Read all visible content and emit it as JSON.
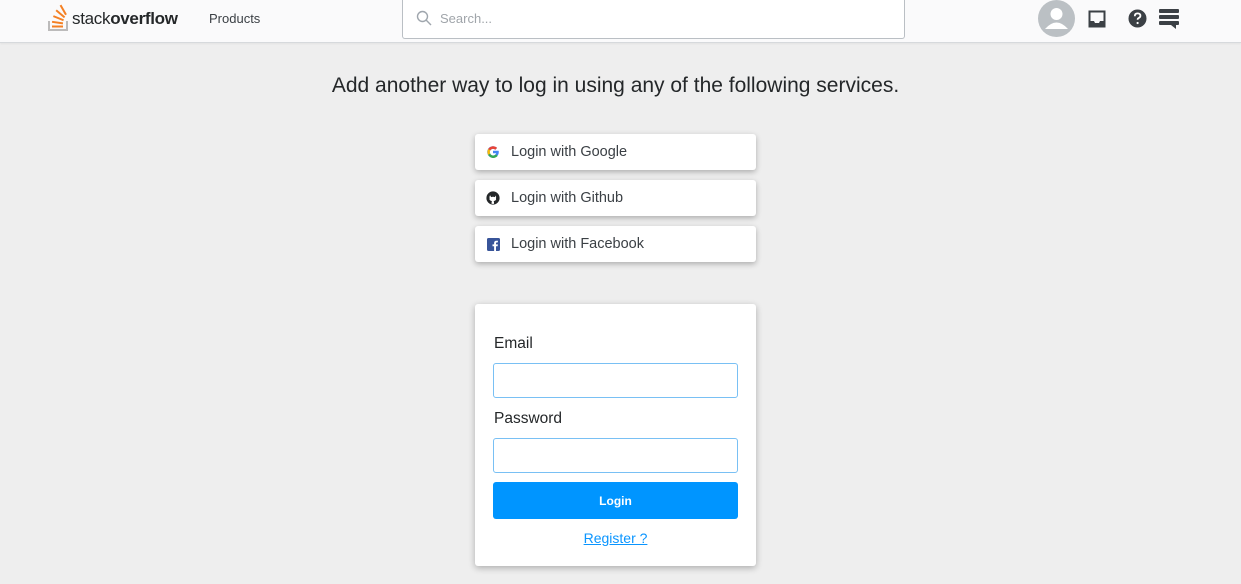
{
  "header": {
    "logo_light": "stack",
    "logo_bold": "overflow",
    "products_label": "Products",
    "search_placeholder": "Search..."
  },
  "main": {
    "headline": "Add another way to log in using any of the following services.",
    "social_buttons": [
      {
        "label": "Login with Google",
        "icon": "google-icon"
      },
      {
        "label": "Login with Github",
        "icon": "github-icon"
      },
      {
        "label": "Login with Facebook",
        "icon": "facebook-icon"
      }
    ],
    "form": {
      "email_label": "Email",
      "email_value": "",
      "password_label": "Password",
      "password_value": "",
      "login_label": "Login",
      "register_label": "Register ?"
    }
  },
  "colors": {
    "brand_orange": "#f48024",
    "primary_blue": "#0095ff",
    "background": "#eeeeee"
  }
}
